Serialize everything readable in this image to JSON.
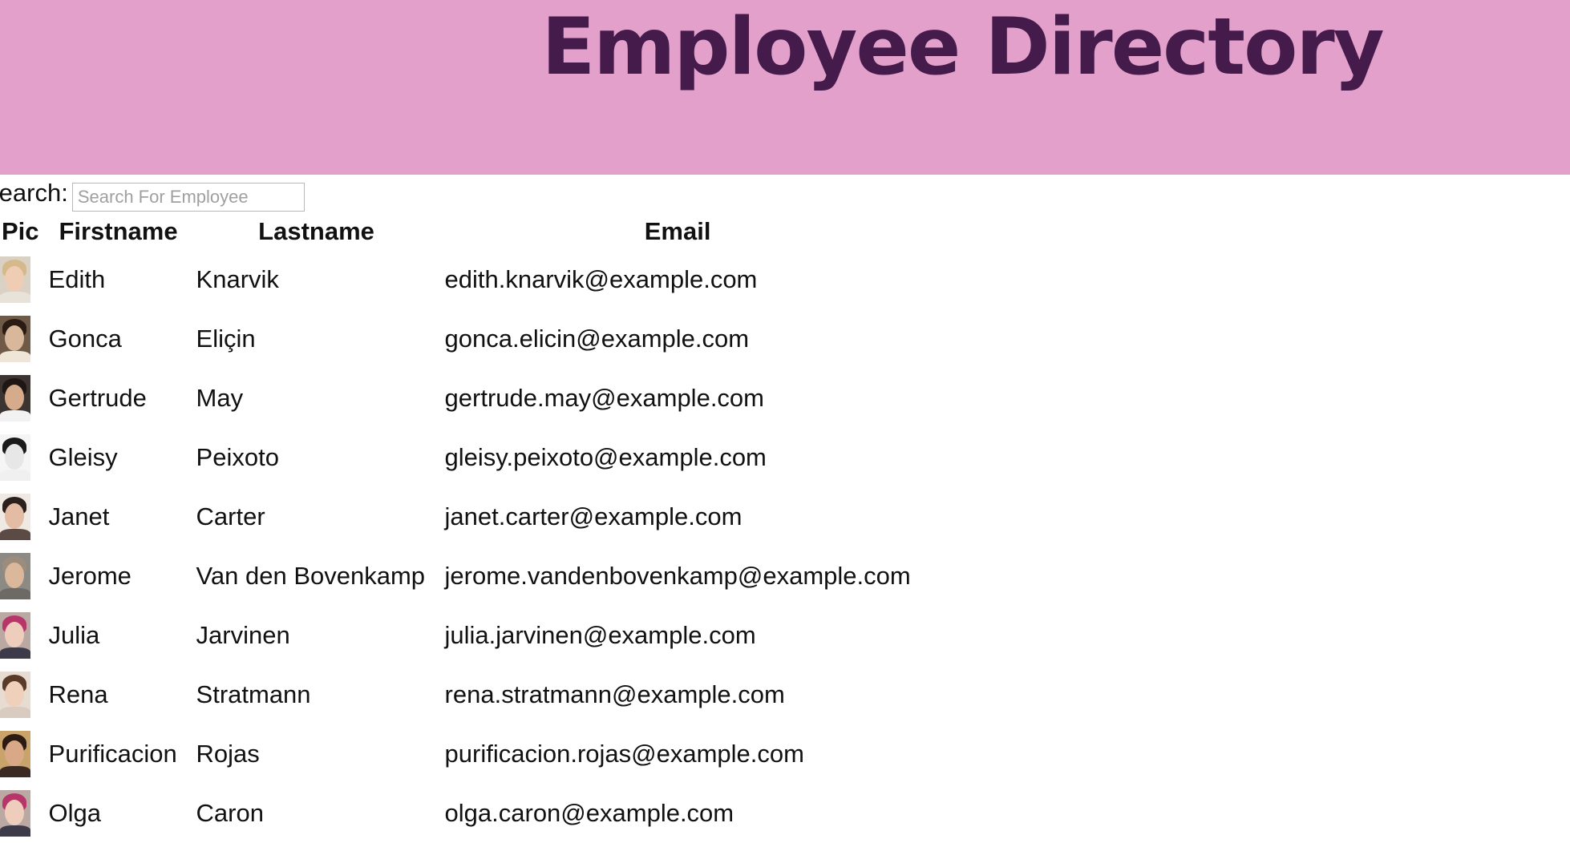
{
  "header": {
    "title": "Employee Directory",
    "background": "#e2a0cb",
    "title_color": "#451b4b"
  },
  "search": {
    "label": "Search:",
    "placeholder": "Search For Employee",
    "value": ""
  },
  "table": {
    "columns": [
      "Pic",
      "Firstname",
      "Lastname",
      "Email"
    ],
    "rows": [
      {
        "first": "Edith",
        "last": "Knarvik",
        "email": "edith.knarvik@example.com",
        "avatar": {
          "bg": "#d9d2c4",
          "hair": "#d6b98a",
          "face": "#efcdb5",
          "body": "#e8e2d8"
        }
      },
      {
        "first": "Gonca",
        "last": "Eliçin",
        "email": "gonca.elicin@example.com",
        "avatar": {
          "bg": "#6e5a47",
          "hair": "#2a1c14",
          "face": "#d8b79a",
          "body": "#efe6d8"
        }
      },
      {
        "first": "Gertrude",
        "last": "May",
        "email": "gertrude.may@example.com",
        "avatar": {
          "bg": "#3c3430",
          "hair": "#1f1714",
          "face": "#d5ab8c",
          "body": "#f2f2f2"
        }
      },
      {
        "first": "Gleisy",
        "last": "Peixoto",
        "email": "gleisy.peixoto@example.com",
        "avatar": {
          "bg": "#f5f5f5",
          "hair": "#1a1a1a",
          "face": "#e7e7e7",
          "body": "#f0f0f0"
        }
      },
      {
        "first": "Janet",
        "last": "Carter",
        "email": "janet.carter@example.com",
        "avatar": {
          "bg": "#efe9e4",
          "hair": "#2b201b",
          "face": "#e3bca3",
          "body": "#5c4a44"
        }
      },
      {
        "first": "Jerome",
        "last": "Van den Bovenkamp",
        "email": "jerome.vandenbovenkamp@example.com",
        "avatar": {
          "bg": "#8c8a84",
          "hair": "#9c8c7c",
          "face": "#dbb79b",
          "body": "#6d6a66"
        }
      },
      {
        "first": "Julia",
        "last": "Jarvinen",
        "email": "julia.jarvinen@example.com",
        "avatar": {
          "bg": "#b9a9a2",
          "hair": "#b8356a",
          "face": "#efcdbd",
          "body": "#3d3a4a"
        }
      },
      {
        "first": "Rena",
        "last": "Stratmann",
        "email": "rena.stratmann@example.com",
        "avatar": {
          "bg": "#e6dcd2",
          "hair": "#5a3a28",
          "face": "#efd0bb",
          "body": "#d9cbbf"
        }
      },
      {
        "first": "Purificacion",
        "last": "Rojas",
        "email": "purificacion.rojas@example.com",
        "avatar": {
          "bg": "#c9a46a",
          "hair": "#2b1b12",
          "face": "#d9a987",
          "body": "#3a2a22"
        }
      },
      {
        "first": "Olga",
        "last": "Caron",
        "email": "olga.caron@example.com",
        "avatar": {
          "bg": "#b9a9a2",
          "hair": "#b8356a",
          "face": "#efcdbd",
          "body": "#3d3a4a"
        }
      }
    ]
  }
}
